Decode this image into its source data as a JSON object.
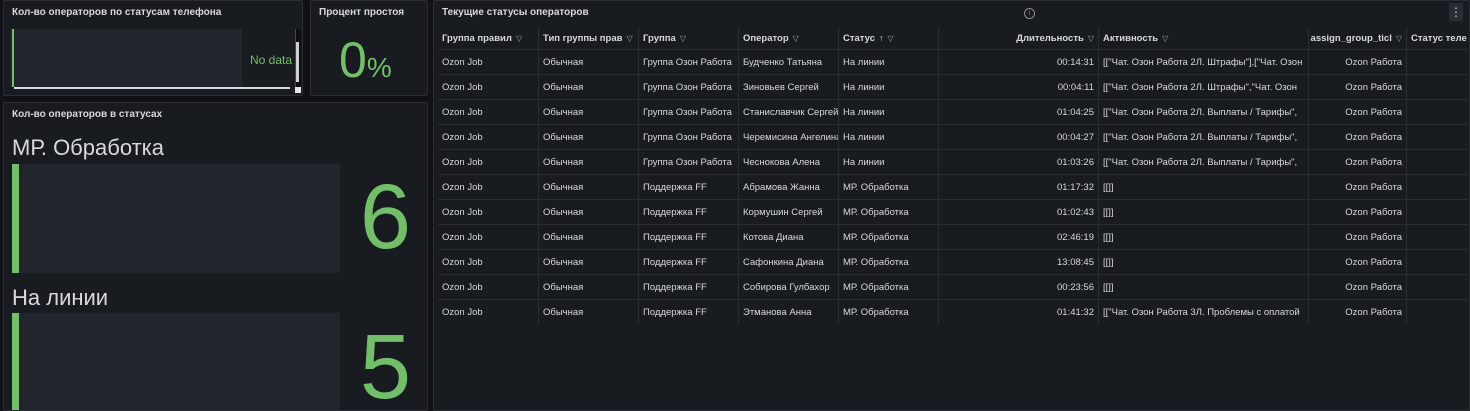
{
  "panel_phone": {
    "title": "Кол-во операторов по статусам телефона",
    "no_data": "No data"
  },
  "panel_idle": {
    "title": "Процент простоя",
    "value": "0",
    "unit": "%"
  },
  "panel_statuses": {
    "title": "Кол-во операторов в статусах",
    "items": [
      {
        "label": "МР. Обработка",
        "value": "6"
      },
      {
        "label": "На линии",
        "value": "5"
      }
    ]
  },
  "panel_table": {
    "title": "Текущие статусы операторов",
    "columns": [
      {
        "label": "Группа правил",
        "filter": true,
        "sort": ""
      },
      {
        "label": "Тип группы прав",
        "filter": true,
        "sort": ""
      },
      {
        "label": "Группа",
        "filter": true,
        "sort": ""
      },
      {
        "label": "Оператор",
        "filter": true,
        "sort": ""
      },
      {
        "label": "Статус",
        "filter": true,
        "sort": "↑"
      },
      {
        "label": "Длительность",
        "filter": true,
        "sort": ""
      },
      {
        "label": "Активность",
        "filter": true,
        "sort": ""
      },
      {
        "label": "assign_group_ticl",
        "filter": true,
        "sort": ""
      },
      {
        "label": "Статус теле",
        "filter": false,
        "sort": ""
      }
    ],
    "rows": [
      [
        "Ozon Job",
        "Обычная",
        "Группа Озон Работа",
        "Будченко Татьяна",
        "На линии",
        "00:14:31",
        "[[\"Чат. Озон Работа 2Л. Штрафы\"],[\"Чат. Озон",
        "Ozon Работа",
        ""
      ],
      [
        "Ozon Job",
        "Обычная",
        "Группа Озон Работа",
        "Зиновьев Сергей",
        "На линии",
        "00:04:11",
        "[[\"Чат. Озон Работа 2Л. Штрафы\",\"Чат. Озон",
        "Ozon Работа",
        ""
      ],
      [
        "Ozon Job",
        "Обычная",
        "Группа Озон Работа",
        "Станиславчик Сергей",
        "На линии",
        "01:04:25",
        "[[\"Чат. Озон Работа 2Л. Выплаты / Тарифы\",",
        "Ozon Работа",
        ""
      ],
      [
        "Ozon Job",
        "Обычная",
        "Группа Озон Работа",
        "Черемисина Ангелина",
        "На линии",
        "00:04:27",
        "[[\"Чат. Озон Работа 2Л. Выплаты / Тарифы\",",
        "Ozon Работа",
        ""
      ],
      [
        "Ozon Job",
        "Обычная",
        "Группа Озон Работа",
        "Чеснокова Алена",
        "На линии",
        "01:03:26",
        "[[\"Чат. Озон Работа 2Л. Выплаты / Тарифы\",",
        "Ozon Работа",
        ""
      ],
      [
        "Ozon Job",
        "Обычная",
        "Поддержка FF",
        "Абрамова Жанна",
        "МР. Обработка",
        "01:17:32",
        "[[]]",
        "Ozon Работа",
        ""
      ],
      [
        "Ozon Job",
        "Обычная",
        "Поддержка FF",
        "Кормушин Сергей",
        "МР. Обработка",
        "01:02:43",
        "[[]]",
        "Ozon Работа",
        ""
      ],
      [
        "Ozon Job",
        "Обычная",
        "Поддержка FF",
        "Котова Диана",
        "МР. Обработка",
        "02:46:19",
        "[[]]",
        "Ozon Работа",
        ""
      ],
      [
        "Ozon Job",
        "Обычная",
        "Поддержка FF",
        "Сафонкина Диана",
        "МР. Обработка",
        "13:08:45",
        "[[]]",
        "Ozon Работа",
        ""
      ],
      [
        "Ozon Job",
        "Обычная",
        "Поддержка FF",
        "Собирова Гулбахор",
        "МР. Обработка",
        "00:23:56",
        "[[]]",
        "Ozon Работа",
        ""
      ],
      [
        "Ozon Job",
        "Обычная",
        "Поддержка FF",
        "Этманова Анна",
        "МР. Обработка",
        "01:41:32",
        "[[\"Чат. Озон Работа 3Л. Проблемы с оплатой",
        "Ozon Работа",
        ""
      ]
    ]
  },
  "colors": {
    "accent_green": "#73bf69",
    "panel_bg": "#181b1f",
    "page_bg": "#111217"
  }
}
